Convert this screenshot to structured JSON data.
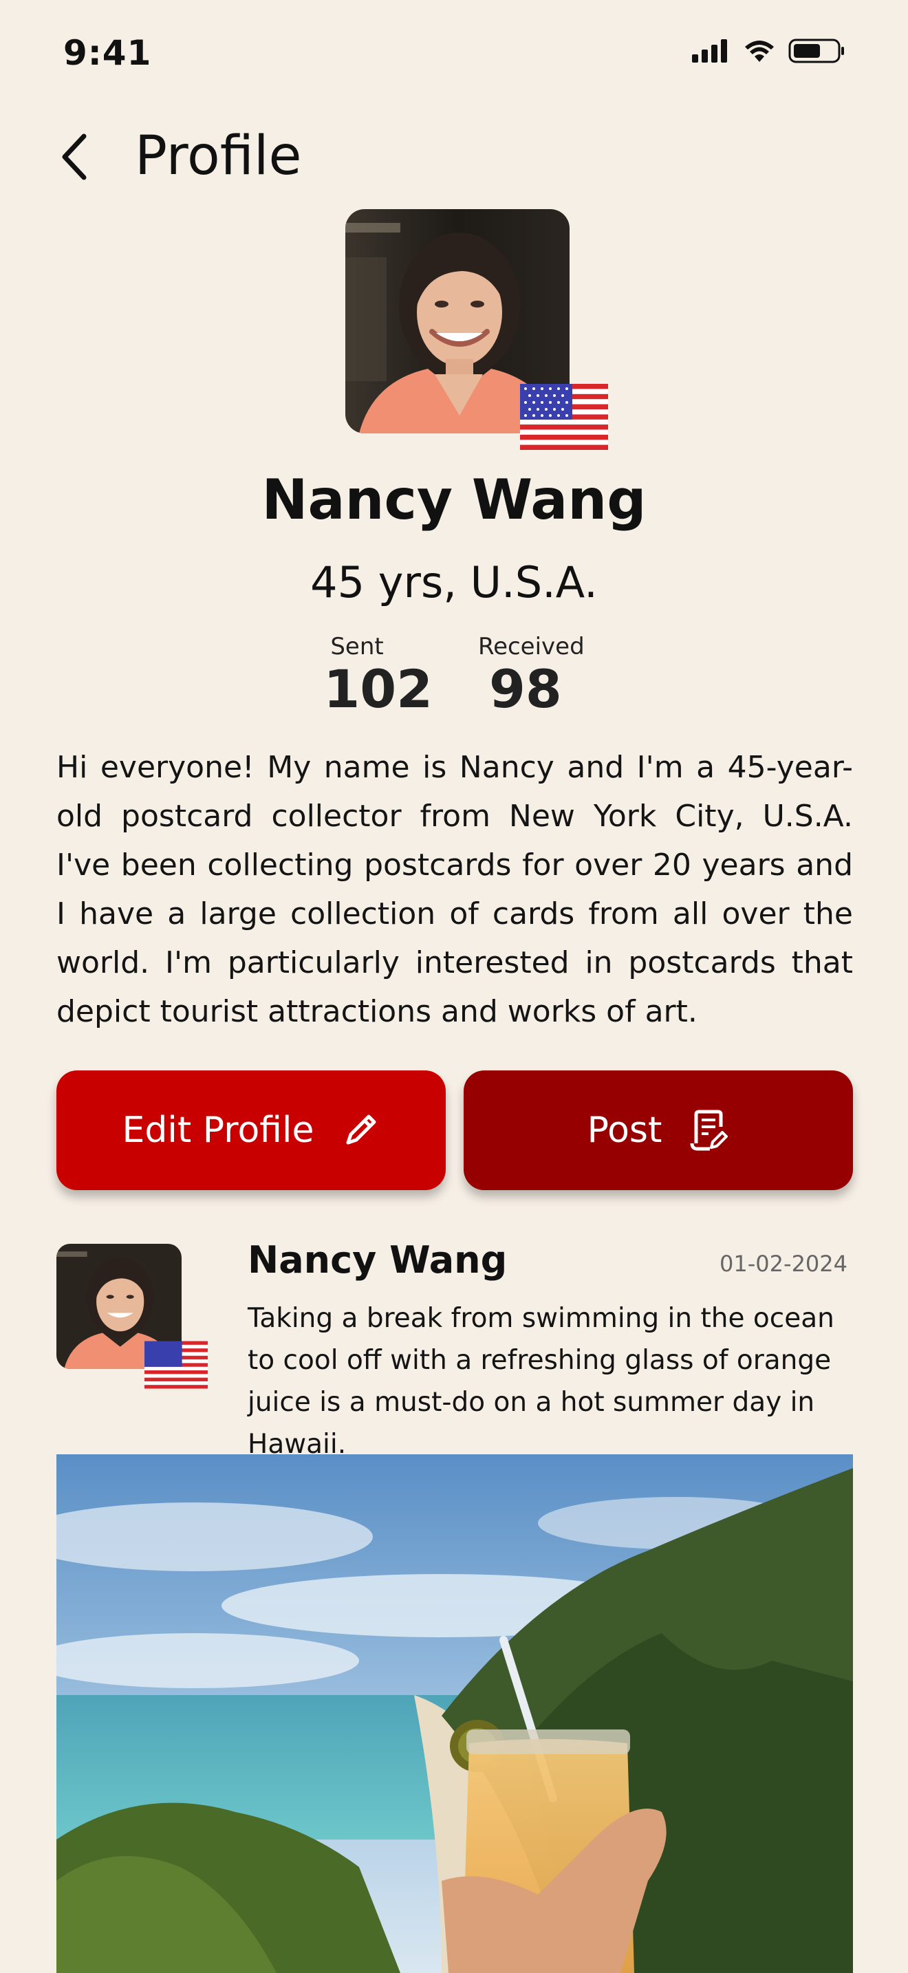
{
  "status_bar": {
    "time": "9:41"
  },
  "nav": {
    "title": "Profile"
  },
  "profile": {
    "name": "Nancy Wang",
    "age_location": "45 yrs, U.S.A.",
    "stats": {
      "sent_label": "Sent",
      "sent_value": "102",
      "received_label": "Received",
      "received_value": "98"
    },
    "bio": "Hi everyone! My name is Nancy and I'm a 45-year-old postcard collector from New York City, U.S.A. I've been collecting postcards for over 20 years and I have a large collection of cards from all over the world. I'm particularly interested in postcards that depict tourist attractions and works of art."
  },
  "actions": {
    "edit_label": "Edit Profile",
    "post_label": "Post"
  },
  "post": {
    "author": "Nancy Wang",
    "date": "01-02-2024",
    "text": "Taking a break from swimming in the ocean to cool off with a refreshing glass of orange juice is a must-do on a hot summer day in Hawaii."
  },
  "colors": {
    "background": "#f6efe6",
    "edit_button": "#c80000",
    "post_button": "#970000"
  },
  "icons": {
    "back": "chevron-left-icon",
    "edit": "pencil-icon",
    "post": "document-edit-icon",
    "flag": "us-flag-icon"
  }
}
